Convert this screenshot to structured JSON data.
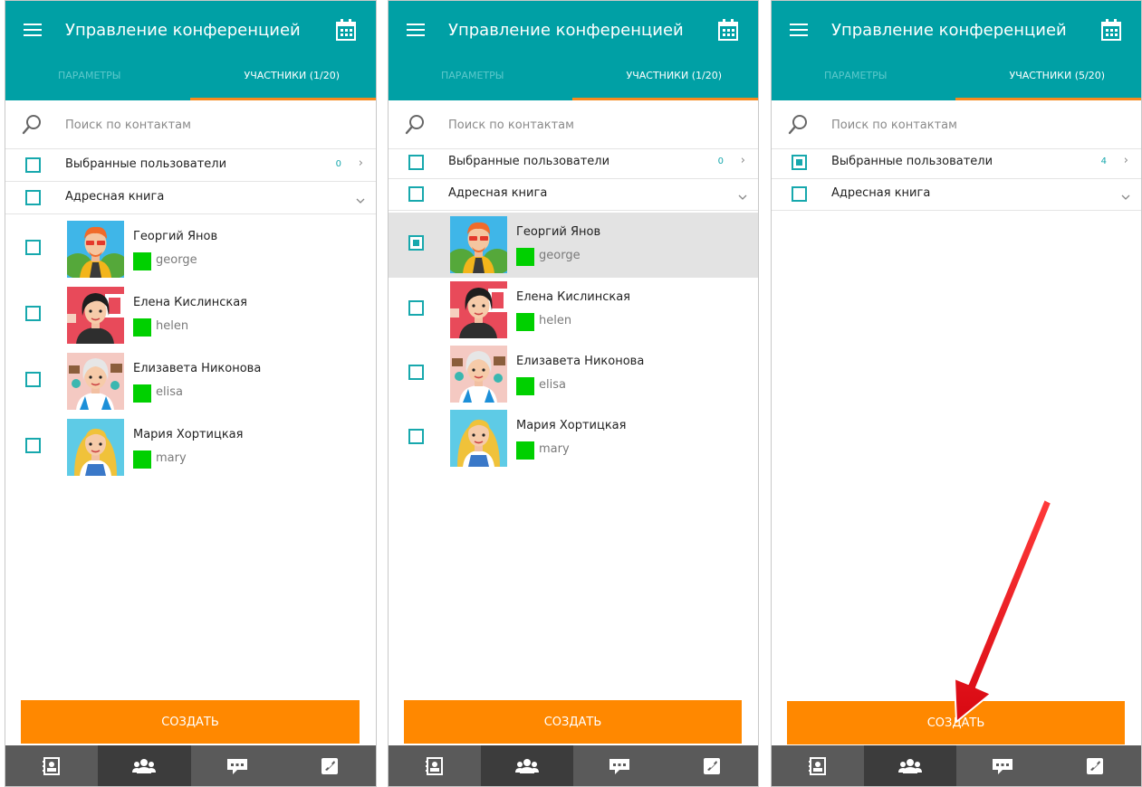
{
  "colors": {
    "header": "#00a0a5",
    "accent": "#17a8ad",
    "tab_underline": "#f68a1e",
    "button": "#ff8800",
    "status_online": "#00d000",
    "bottom_nav": "#5a5a5a",
    "annotation_arrow": "#e8141e"
  },
  "icons": {
    "menu": "hamburger-menu-icon",
    "calendar": "calendar-icon",
    "search": "search-icon",
    "nav": [
      "contacts-book-icon",
      "group-icon",
      "chat-icon",
      "phone-icon"
    ]
  },
  "panels": [
    {
      "title": "Управление конференцией",
      "tabs": {
        "params": "ПАРАМЕТРЫ",
        "members": "УЧАСТНИКИ (1/20)"
      },
      "search_placeholder": "Поиск по контактам",
      "selected_users": {
        "label": "Выбранные пользователи",
        "count": "0",
        "checked": false
      },
      "address_book": {
        "label": "Адресная книга",
        "checked": false,
        "expanded": true
      },
      "contacts": [
        {
          "name": "Георгий Янов",
          "login": "george",
          "checked": false,
          "selected": false,
          "avatar": "george"
        },
        {
          "name": "Елена Кислинская",
          "login": "helen",
          "checked": false,
          "selected": false,
          "avatar": "helen"
        },
        {
          "name": "Елизавета Никонова",
          "login": "elisa",
          "checked": false,
          "selected": false,
          "avatar": "elisa"
        },
        {
          "name": "Мария Хортицкая",
          "login": "mary",
          "checked": false,
          "selected": false,
          "avatar": "mary"
        }
      ],
      "create_label": "СОЗДАТЬ",
      "active_nav": 1
    },
    {
      "title": "Управление конференцией",
      "tabs": {
        "params": "ПАРАМЕТРЫ",
        "members": "УЧАСТНИКИ (1/20)"
      },
      "search_placeholder": "Поиск по контактам",
      "selected_users": {
        "label": "Выбранные пользователи",
        "count": "0",
        "checked": false
      },
      "address_book": {
        "label": "Адресная книга",
        "checked": false,
        "expanded": true
      },
      "contacts": [
        {
          "name": "Георгий Янов",
          "login": "george",
          "checked": true,
          "selected": true,
          "avatar": "george"
        },
        {
          "name": "Елена Кислинская",
          "login": "helen",
          "checked": false,
          "selected": false,
          "avatar": "helen"
        },
        {
          "name": "Елизавета Никонова",
          "login": "elisa",
          "checked": false,
          "selected": false,
          "avatar": "elisa"
        },
        {
          "name": "Мария Хортицкая",
          "login": "mary",
          "checked": false,
          "selected": false,
          "avatar": "mary"
        }
      ],
      "create_label": "СОЗДАТЬ",
      "active_nav": 1
    },
    {
      "title": "Управление конференцией",
      "tabs": {
        "params": "ПАРАМЕТРЫ",
        "members": "УЧАСТНИКИ (5/20)"
      },
      "search_placeholder": "Поиск по контактам",
      "selected_users": {
        "label": "Выбранные пользователи",
        "count": "4",
        "checked": true
      },
      "address_book": {
        "label": "Адресная книга",
        "checked": false,
        "expanded": true
      },
      "contacts": [],
      "create_label": "СОЗДАТЬ",
      "active_nav": 1
    }
  ]
}
